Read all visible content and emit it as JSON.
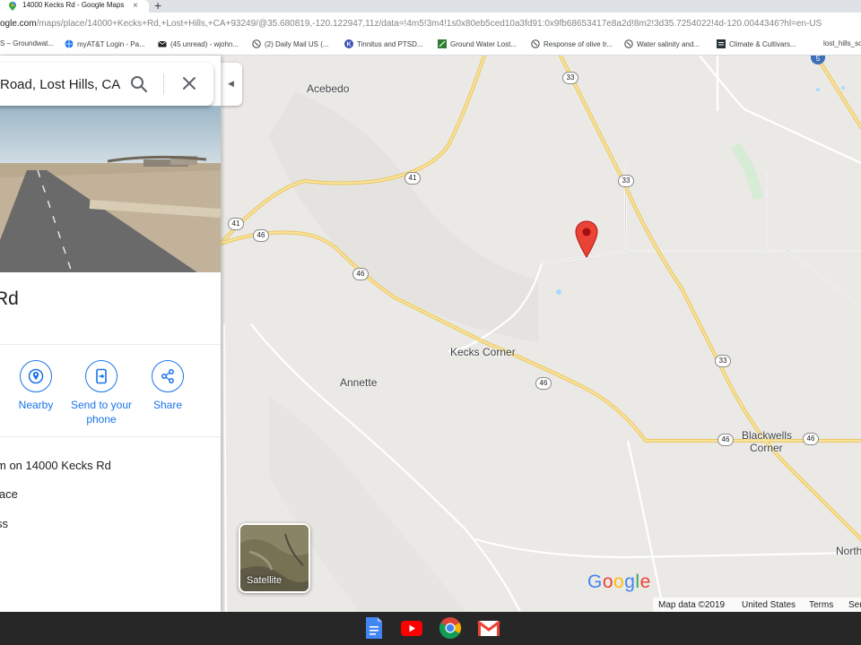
{
  "browser": {
    "tab_title": "14000 Kecks Rd - Google Maps",
    "tab_close": "×",
    "new_tab": "+",
    "url_host": "ogle.com",
    "url_path": "/maps/place/14000+Kecks+Rd,+Lost+Hills,+CA+93249/@35.680819,-120.122947,11z/data=!4m5!3m4!1s0x80eb5ced10a3fd91:0x9fb68653417e8a2d!8m2!3d35.7254022!4d-120.0044346?hl=en-US",
    "bookmarks": [
      {
        "label": "S – Groundwat...",
        "icon": "bookmark-icon"
      },
      {
        "label": "myAT&T Login - Pa...",
        "icon": "globe-icon"
      },
      {
        "label": "(45 unread) - wjohn...",
        "icon": "mail-icon"
      },
      {
        "label": "(2) Daily Mail US (...",
        "icon": "globe-icon"
      },
      {
        "label": "Tinnitus and PTSD...",
        "icon": "k-icon"
      },
      {
        "label": "Ground Water Lost...",
        "icon": "leaf-icon"
      },
      {
        "label": "Response of olive tr...",
        "icon": "globe-icon"
      },
      {
        "label": "Water salinity and...",
        "icon": "globe-icon"
      },
      {
        "label": "Climate & Cultivars...",
        "icon": "doc-icon"
      },
      {
        "label": "lost_hills_soi",
        "icon": "none"
      }
    ]
  },
  "panel": {
    "search_value": "Road, Lost Hills, CA",
    "place_title": "Rd",
    "actions": [
      {
        "label": "Nearby",
        "icon": "nearby-icon"
      },
      {
        "label": "Send to your phone",
        "icon": "send-to-phone-icon"
      },
      {
        "label": "Share",
        "icon": "share-icon"
      }
    ],
    "rows": [
      "m on 14000 Kecks Rd",
      "lace",
      "ss"
    ]
  },
  "map": {
    "places": {
      "acebedo": "Acebedo",
      "kecks_corner": "Kecks Corner",
      "annette": "Annette",
      "blackwells_1": "Blackwells",
      "blackwells_2": "Corner",
      "north": "North"
    },
    "shields": {
      "hwy33": "33",
      "hwy41": "41",
      "hwy46": "46",
      "i5": "5"
    },
    "satellite_label": "Satellite",
    "google_logo": [
      "G",
      "o",
      "o",
      "g",
      "l",
      "e"
    ],
    "footer": {
      "map_data": "Map data ©2019",
      "country": "United States",
      "terms": "Terms",
      "send": "Sen"
    }
  },
  "colors": {
    "google_blue": "#4285f4",
    "google_red": "#ea4335",
    "google_yellow": "#fbbc05",
    "google_green": "#34a853",
    "action_blue": "#1a73e8",
    "road_yellow": "#f6d36b",
    "pin_red": "#ea4335"
  },
  "shelf_apps": [
    "docs-icon",
    "youtube-icon",
    "chrome-icon",
    "gmail-icon"
  ]
}
